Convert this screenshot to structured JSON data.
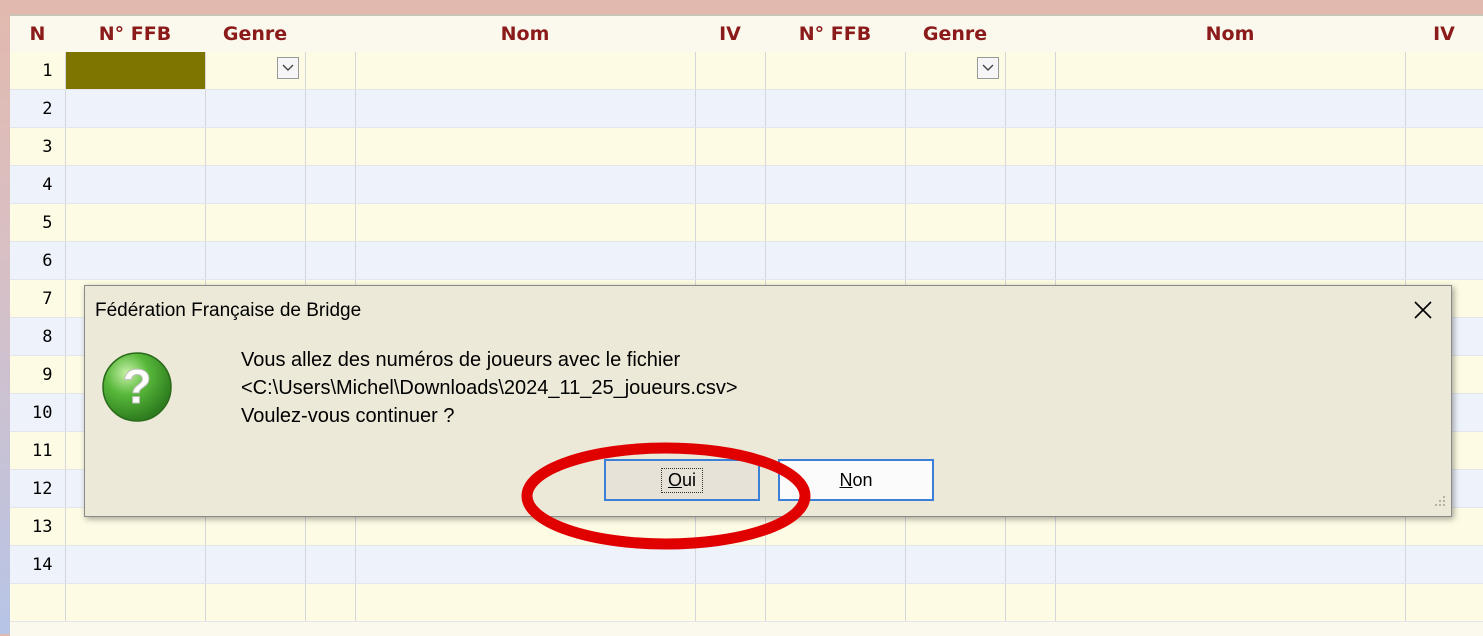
{
  "table": {
    "headers": [
      "N",
      "N° FFB",
      "Genre",
      "Nom",
      "IV",
      "N° FFB",
      "Genre",
      "Nom",
      "IV"
    ],
    "row_numbers": [
      "1",
      "2",
      "3",
      "4",
      "5",
      "6",
      "7",
      "8",
      "9",
      "10",
      "11",
      "12",
      "13",
      "14",
      ""
    ]
  },
  "dialog": {
    "title": "Fédération Française de Bridge",
    "message_lines": [
      "Vous allez des numéros de joueurs avec le fichier",
      "<C:\\Users\\Michel\\Downloads\\2024_11_25_joueurs.csv>",
      "Voulez-vous continuer ?"
    ],
    "yes_button": {
      "mnemonic": "O",
      "rest": "ui"
    },
    "no_button": {
      "mnemonic": "N",
      "rest": "on"
    },
    "icon": "question-icon"
  },
  "colors": {
    "header_text": "#8b1a1a",
    "active_cell": "#7e7400",
    "row_odd": "#fdfbe3",
    "row_even": "#eef3fb",
    "annotation": "#e00000"
  }
}
